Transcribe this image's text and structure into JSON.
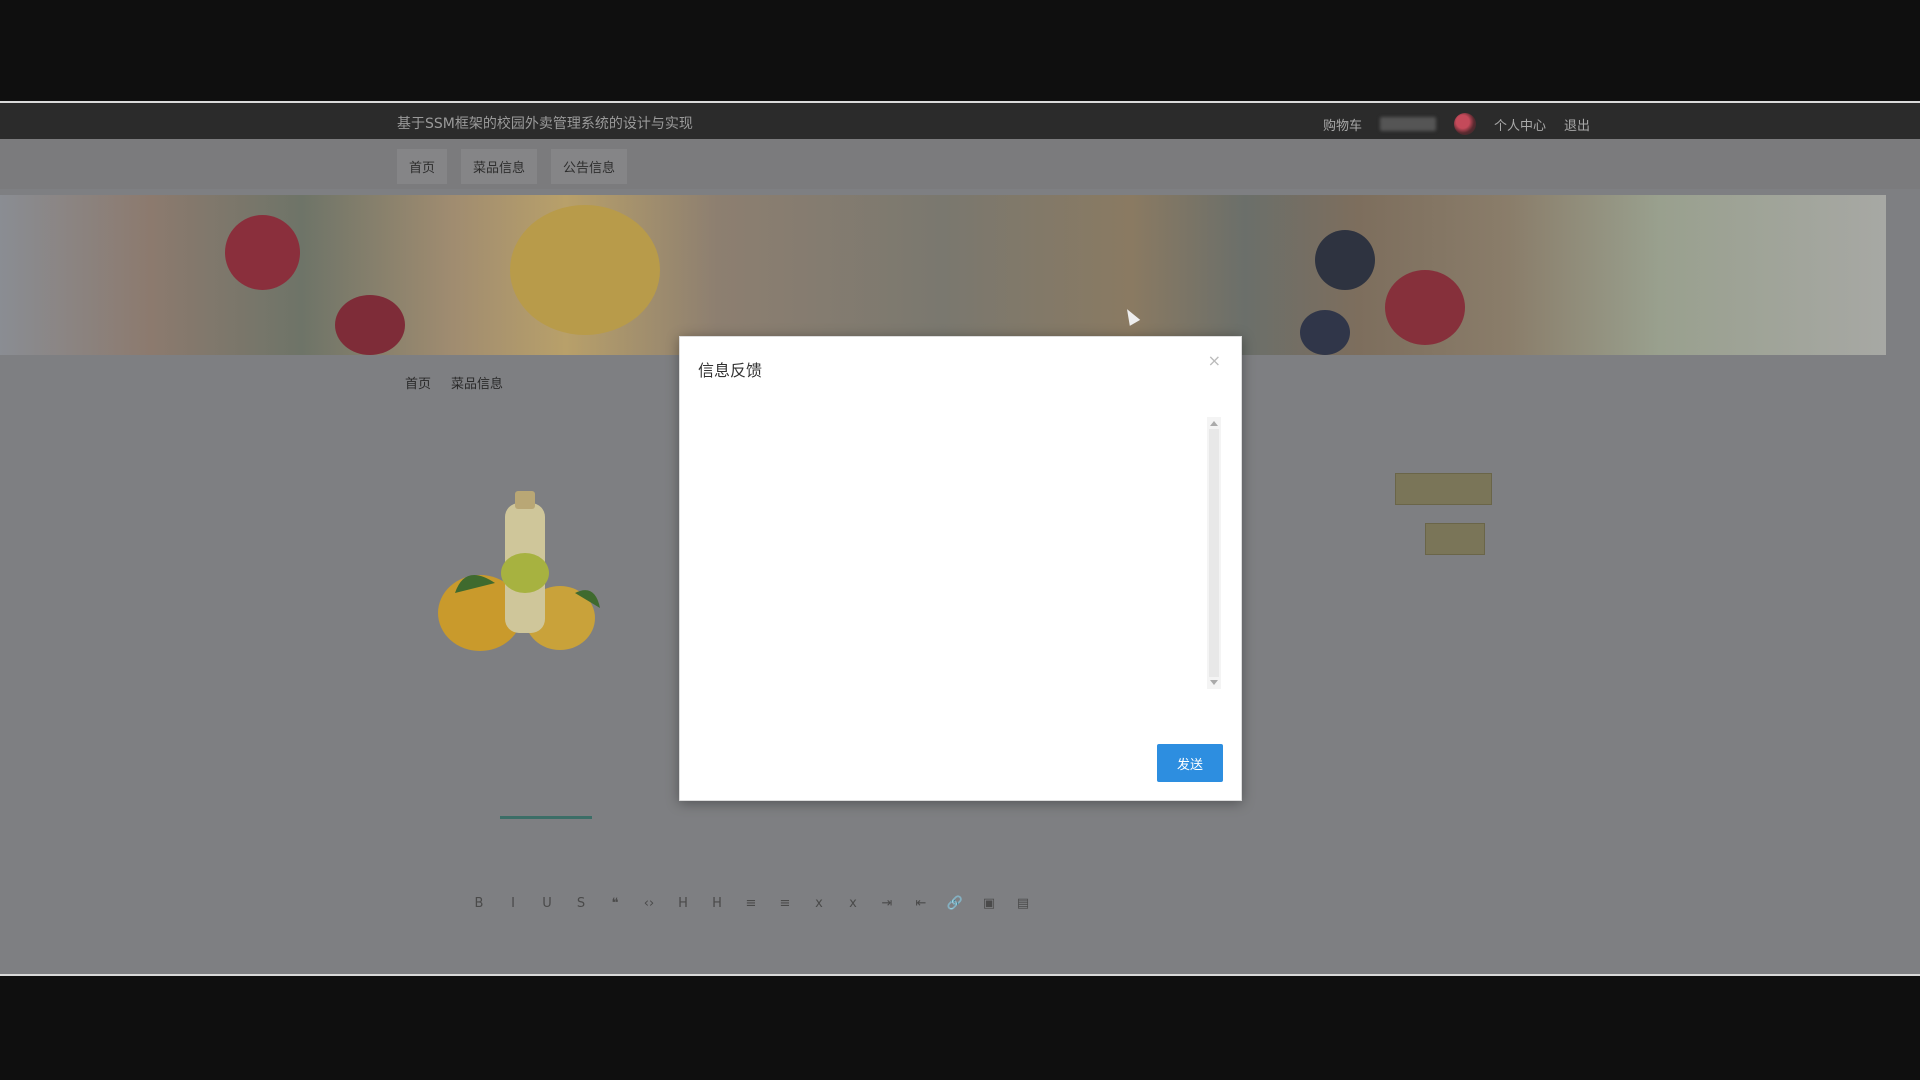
{
  "header": {
    "site_title": "基于SSM框架的校园外卖管理系统的设计与实现",
    "cart": "购物车",
    "personal_center": "个人中心",
    "logout": "退出"
  },
  "nav": {
    "items": [
      {
        "label": "首页"
      },
      {
        "label": "菜品信息"
      },
      {
        "label": "公告信息"
      }
    ]
  },
  "breadcrumb": {
    "home": "首页",
    "category": "菜品信息"
  },
  "modal": {
    "title": "信息反馈",
    "close": "×",
    "send_label": "发送"
  },
  "colors": {
    "accent": "#2d8ee0",
    "olive": "#7a7558"
  }
}
